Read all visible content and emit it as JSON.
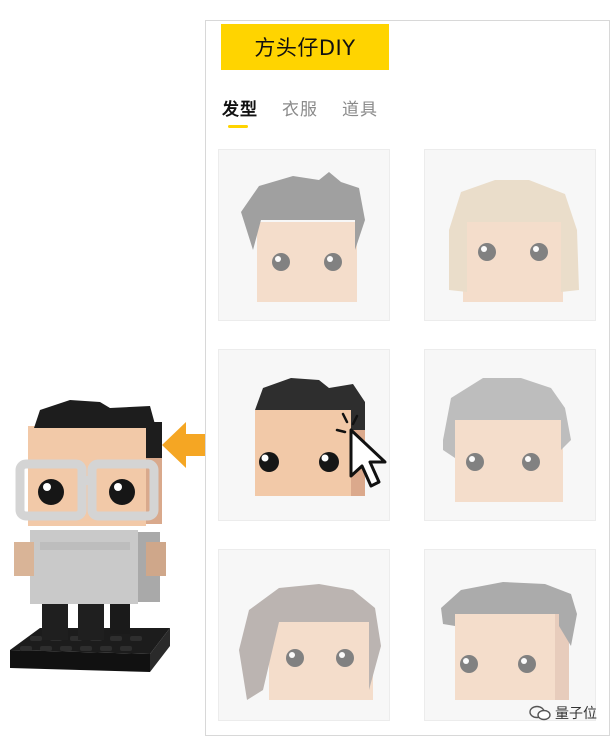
{
  "app": {
    "title": "方头仔DIY"
  },
  "tabs": [
    {
      "label": "发型",
      "active": true
    },
    {
      "label": "衣服",
      "active": false
    },
    {
      "label": "道具",
      "active": false
    }
  ],
  "hairstyles": [
    {
      "name": "dark-spiky-hair",
      "color": "#5a5a5a",
      "selected": false
    },
    {
      "name": "long-blonde-hair",
      "color": "#e0c9a6",
      "selected": false
    },
    {
      "name": "black-side-part-hair",
      "color": "#2e2e2e",
      "selected": true
    },
    {
      "name": "gray-bob-hair",
      "color": "#8e8e8e",
      "selected": false
    },
    {
      "name": "brown-long-hair",
      "color": "#8b7e78",
      "selected": false
    },
    {
      "name": "gray-short-hair",
      "color": "#6e6e6e",
      "selected": false
    }
  ],
  "watermark": {
    "text": "量子位"
  },
  "colors": {
    "accent": "#ffd400",
    "arrow": "#f5a623",
    "skin": "#f2c9a8"
  }
}
